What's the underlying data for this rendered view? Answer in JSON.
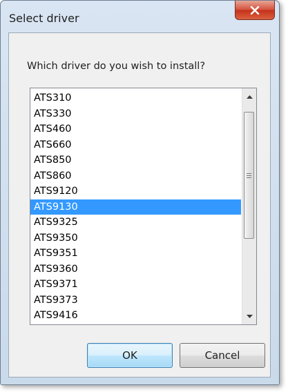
{
  "window": {
    "title": "Select driver"
  },
  "dialog": {
    "prompt": "Which driver do you wish to install?",
    "drivers": [
      {
        "label": "ATS310",
        "selected": false
      },
      {
        "label": "ATS330",
        "selected": false
      },
      {
        "label": "ATS460",
        "selected": false
      },
      {
        "label": "ATS660",
        "selected": false
      },
      {
        "label": "ATS850",
        "selected": false
      },
      {
        "label": "ATS860",
        "selected": false
      },
      {
        "label": "ATS9120",
        "selected": false
      },
      {
        "label": "ATS9130",
        "selected": true
      },
      {
        "label": "ATS9325",
        "selected": false
      },
      {
        "label": "ATS9350",
        "selected": false
      },
      {
        "label": "ATS9351",
        "selected": false
      },
      {
        "label": "ATS9360",
        "selected": false
      },
      {
        "label": "ATS9371",
        "selected": false
      },
      {
        "label": "ATS9373",
        "selected": false
      },
      {
        "label": "ATS9416",
        "selected": false
      }
    ],
    "ok_label": "OK",
    "cancel_label": "Cancel"
  },
  "icons": {
    "close": "close-x-icon",
    "scroll_up": "scroll-up-arrow-icon",
    "scroll_down": "scroll-down-arrow-icon",
    "thumb_grip": "scroll-grip-icon"
  },
  "colors": {
    "selection": "#3399ff",
    "close_button": "#c5321b",
    "window_frame": "#c9daeb",
    "dialog_background": "#f0f0f0"
  }
}
